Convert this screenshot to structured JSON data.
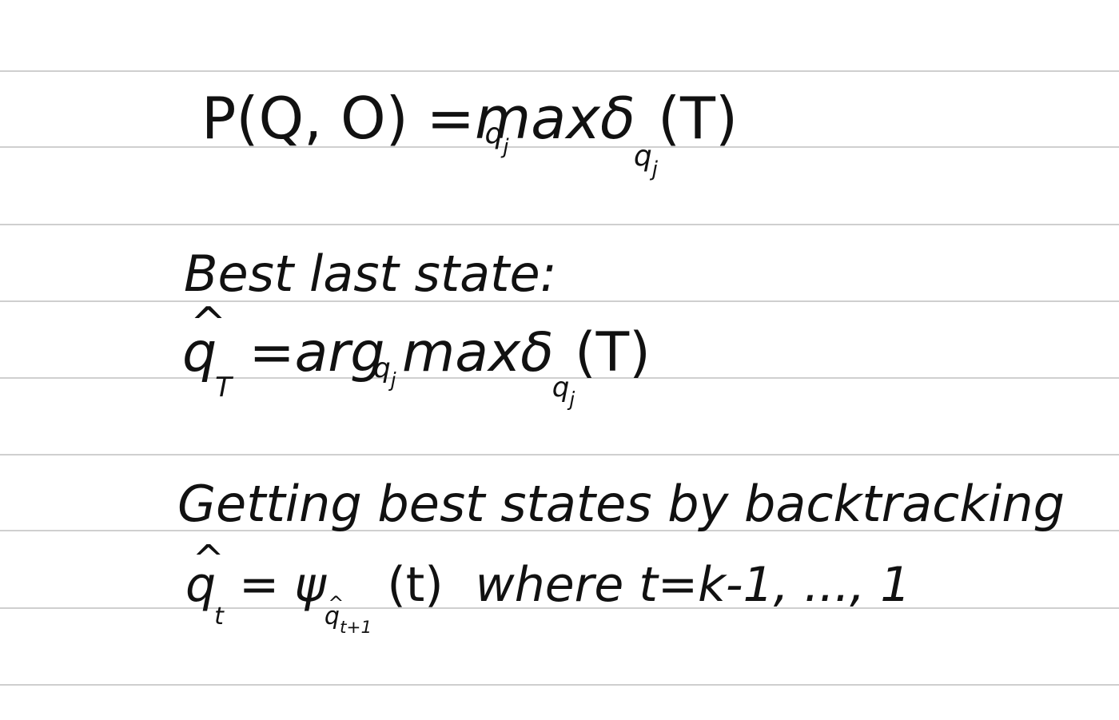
{
  "equation1": {
    "lhs": "P(Q, O)",
    "equals": "=",
    "op": "max",
    "op_sub": "q",
    "op_sub_sub": "j",
    "delta": "δ",
    "delta_sub": "q",
    "delta_sub_sub": "j",
    "arg": "(T)"
  },
  "section2": {
    "heading": "Best last state:",
    "lhs_var": "q",
    "lhs_sub": "T",
    "equals": "=",
    "op": "arg max",
    "op_sub": "q",
    "op_sub_sub": "j",
    "delta": "δ",
    "delta_sub": "q",
    "delta_sub_sub": "j",
    "arg": "(T)"
  },
  "section3": {
    "heading": "Getting best states by backtracking",
    "lhs_var": "q",
    "lhs_sub": "t",
    "equals": "=",
    "psi": "ψ",
    "psi_sub_var": "q",
    "psi_sub_sub": "t+1",
    "arg": "(t)",
    "condition": "where t=k-1, ..., 1"
  }
}
